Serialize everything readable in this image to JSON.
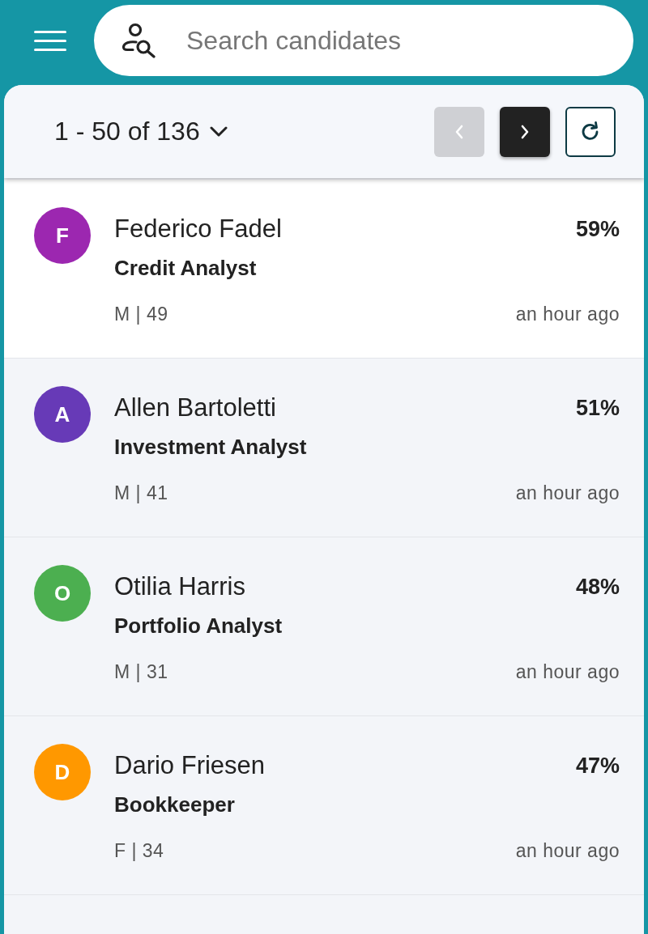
{
  "search": {
    "placeholder": "Search candidates"
  },
  "pagination": {
    "range": "1 - 50 of 136",
    "prev": {
      "disabled": true
    },
    "next": {
      "disabled": false
    }
  },
  "candidates": [
    {
      "initial": "F",
      "color": "#9c27b0",
      "name": "Federico Fadel",
      "title": "Credit Analyst",
      "meta": "M | 49",
      "score": "59%",
      "time": "an hour ago",
      "selected": true
    },
    {
      "initial": "A",
      "color": "#673ab7",
      "name": "Allen Bartoletti",
      "title": "Investment Analyst",
      "meta": "M | 41",
      "score": "51%",
      "time": "an hour ago",
      "selected": false
    },
    {
      "initial": "O",
      "color": "#4caf50",
      "name": "Otilia Harris",
      "title": "Portfolio Analyst",
      "meta": "M | 31",
      "score": "48%",
      "time": "an hour ago",
      "selected": false
    },
    {
      "initial": "D",
      "color": "#ff9800",
      "name": "Dario Friesen",
      "title": "Bookkeeper",
      "meta": "F | 34",
      "score": "47%",
      "time": "an hour ago",
      "selected": false
    }
  ]
}
